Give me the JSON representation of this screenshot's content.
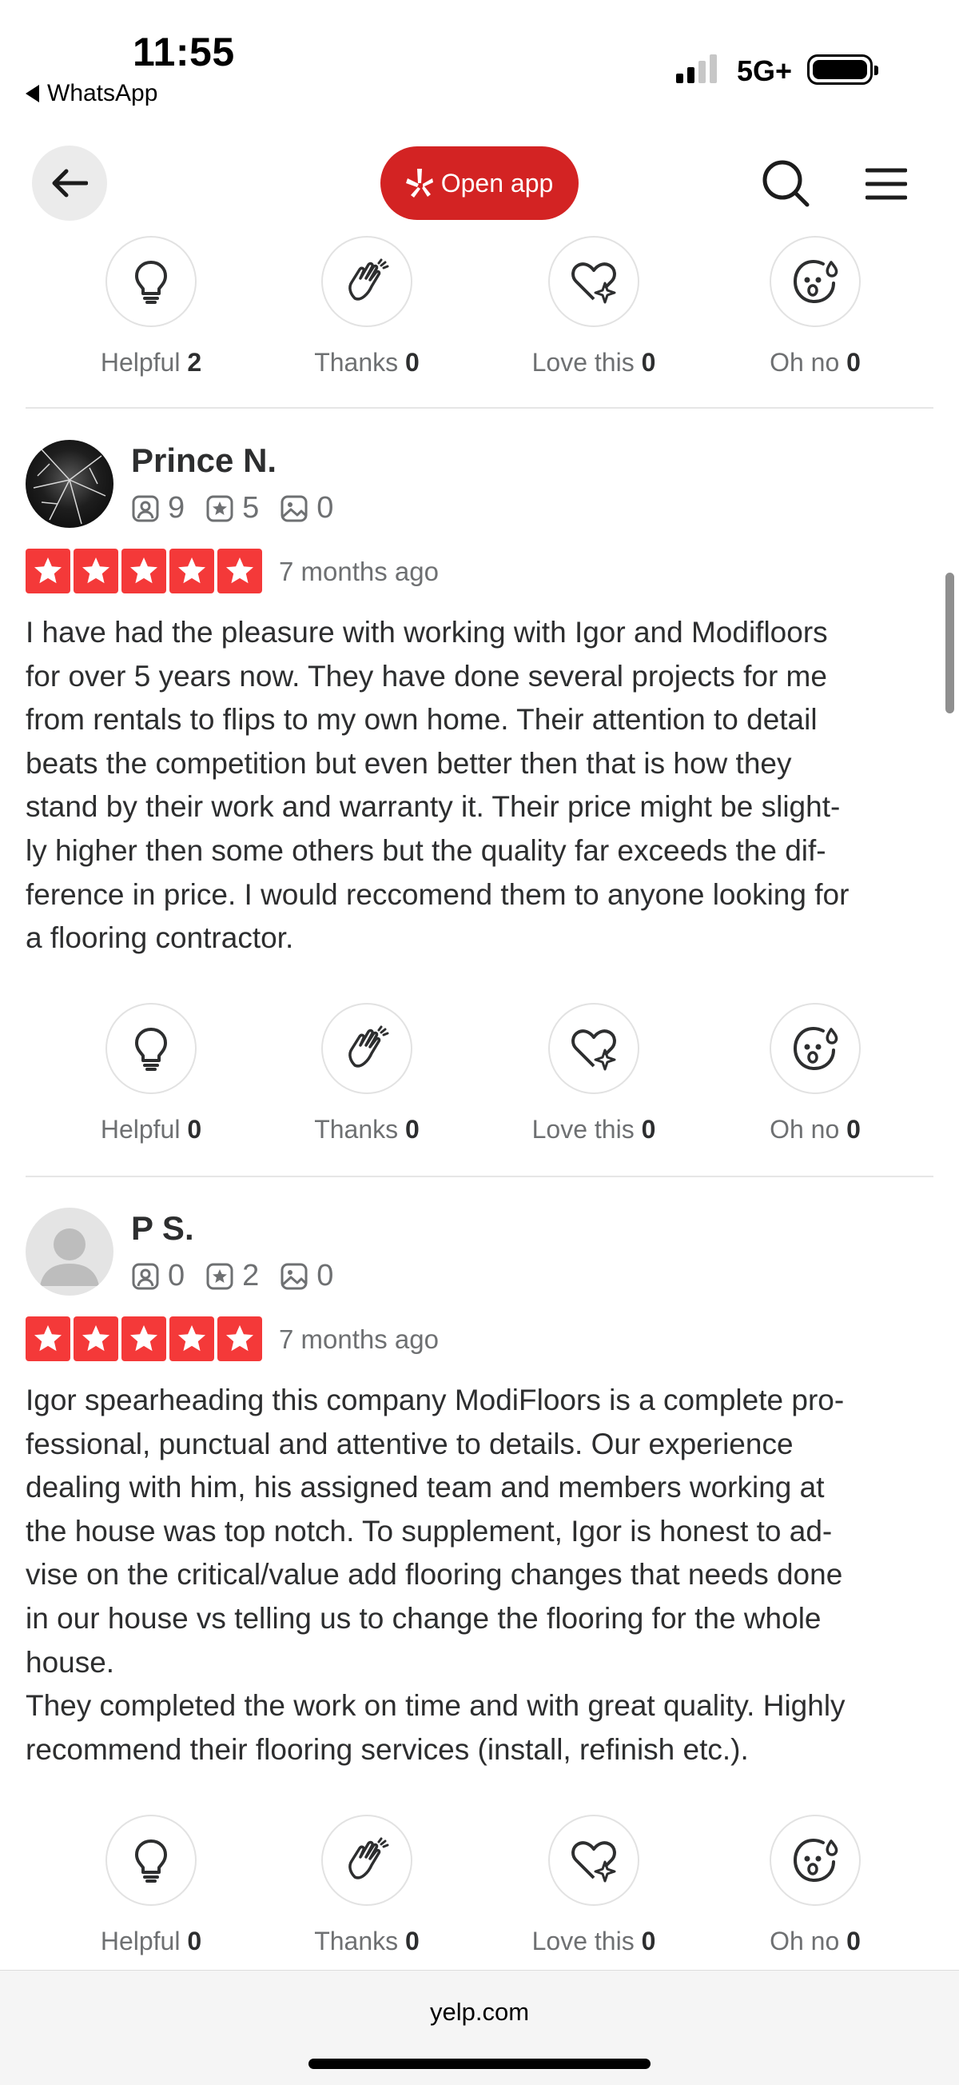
{
  "status_bar": {
    "time": "11:55",
    "back_app": "WhatsApp",
    "network": "5G+"
  },
  "header": {
    "back_icon": "arrow-left-icon",
    "open_app_label": "Open app",
    "brand_color": "#d32323",
    "search_icon": "search-icon",
    "menu_icon": "hamburger-menu-icon"
  },
  "top_reactions": {
    "helpful": {
      "label": "Helpful",
      "count": "2"
    },
    "thanks": {
      "label": "Thanks",
      "count": "0"
    },
    "love": {
      "label": "Love this",
      "count": "0"
    },
    "ohno": {
      "label": "Oh no",
      "count": "0"
    }
  },
  "reviews": [
    {
      "name": "Prince N.",
      "friends": "9",
      "reviews": "5",
      "photos": "0",
      "rating": 5,
      "date": "7 months ago",
      "text": "I have had the pleasure with working with Igor and Modifloors\nfor over 5 years now. They have done several projects for me\nfrom rentals to flips to my own home. Their attention to detail\nbeats the competition but even better then that is how they\nstand by their work and warranty it. Their price might be slight-\nly higher then some others but the quality far exceeds the dif-\nference in price. I would reccomend them to anyone looking for\na flooring contractor.",
      "reactions": {
        "helpful": {
          "label": "Helpful",
          "count": "0"
        },
        "thanks": {
          "label": "Thanks",
          "count": "0"
        },
        "love": {
          "label": "Love this",
          "count": "0"
        },
        "ohno": {
          "label": "Oh no",
          "count": "0"
        }
      }
    },
    {
      "name": "P S.",
      "friends": "0",
      "reviews": "2",
      "photos": "0",
      "rating": 5,
      "date": "7 months ago",
      "text": "Igor spearheading this company ModiFloors is a complete pro-\nfessional, punctual and attentive to details. Our experience\ndealing with him, his assigned team and members working at\nthe house was top notch. To supplement, Igor is honest to ad-\nvise on the critical/value add flooring changes that needs done\nin our house vs telling us to change the flooring for the whole\nhouse.\nThey completed the work on time and with great quality. Highly\nrecommend their flooring services (install, refinish etc.).",
      "reactions": {
        "helpful": {
          "label": "Helpful",
          "count": "0"
        },
        "thanks": {
          "label": "Thanks",
          "count": "0"
        },
        "love": {
          "label": "Love this",
          "count": "0"
        },
        "ohno": {
          "label": "Oh no",
          "count": "0"
        }
      }
    }
  ],
  "colors": {
    "star_red": "#f43939",
    "text_dark": "#2d2e2f",
    "text_gray": "#6e7072"
  },
  "bottom_bar": {
    "url": "yelp.com"
  }
}
